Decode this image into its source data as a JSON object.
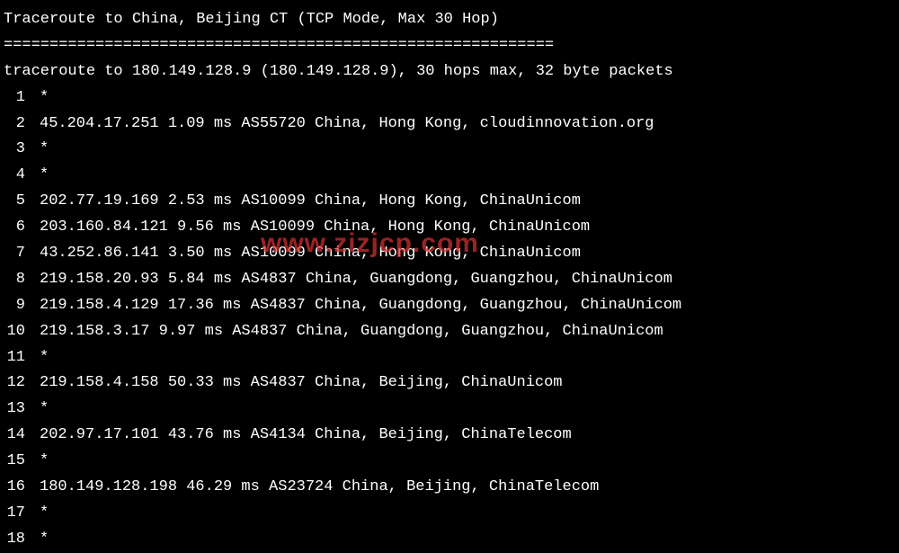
{
  "header": {
    "title": "Traceroute to China, Beijing CT (TCP Mode, Max 30 Hop)",
    "separator": "============================================================",
    "summary": "traceroute to 180.149.128.9 (180.149.128.9), 30 hops max, 32 byte packets"
  },
  "hops": [
    {
      "num": " 1",
      "text": "*"
    },
    {
      "num": " 2",
      "text": "45.204.17.251  1.09 ms  AS55720  China, Hong Kong, cloudinnovation.org"
    },
    {
      "num": " 3",
      "text": "*"
    },
    {
      "num": " 4",
      "text": "*"
    },
    {
      "num": " 5",
      "text": "202.77.19.169  2.53 ms  AS10099  China, Hong Kong, ChinaUnicom"
    },
    {
      "num": " 6",
      "text": "203.160.84.121  9.56 ms  AS10099  China, Hong Kong, ChinaUnicom"
    },
    {
      "num": " 7",
      "text": "43.252.86.141  3.50 ms  AS10099  China, Hong Kong, ChinaUnicom"
    },
    {
      "num": " 8",
      "text": "219.158.20.93  5.84 ms  AS4837  China, Guangdong, Guangzhou, ChinaUnicom"
    },
    {
      "num": " 9",
      "text": "219.158.4.129  17.36 ms  AS4837  China, Guangdong, Guangzhou, ChinaUnicom"
    },
    {
      "num": "10",
      "text": "219.158.3.17  9.97 ms  AS4837  China, Guangdong, Guangzhou, ChinaUnicom"
    },
    {
      "num": "11",
      "text": "*"
    },
    {
      "num": "12",
      "text": "219.158.4.158  50.33 ms  AS4837  China, Beijing, ChinaUnicom"
    },
    {
      "num": "13",
      "text": "*"
    },
    {
      "num": "14",
      "text": "202.97.17.101  43.76 ms  AS4134  China, Beijing, ChinaTelecom"
    },
    {
      "num": "15",
      "text": "*"
    },
    {
      "num": "16",
      "text": "180.149.128.198  46.29 ms  AS23724  China, Beijing, ChinaTelecom"
    },
    {
      "num": "17",
      "text": "*"
    },
    {
      "num": "18",
      "text": "*"
    }
  ],
  "watermark": "www.zizjcp.com"
}
